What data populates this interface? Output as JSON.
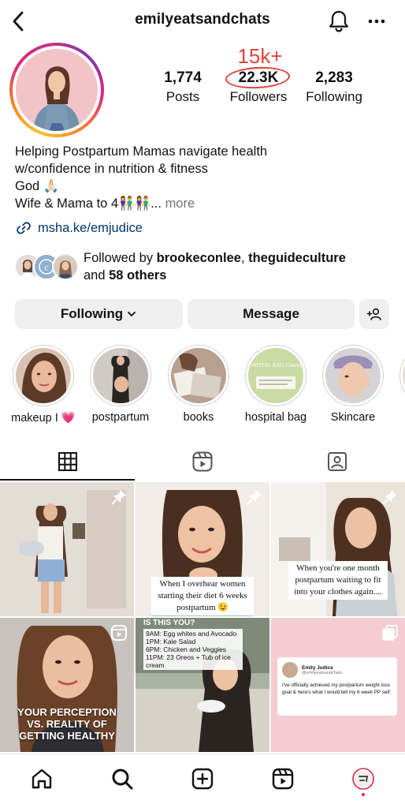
{
  "header": {
    "username": "emilyeatsandchats",
    "icons": {
      "back": "chevron-left-icon",
      "notifications": "bell-icon",
      "more": "more-horizontal-icon"
    }
  },
  "profile": {
    "stats": [
      {
        "value": "1,774",
        "label": "Posts"
      },
      {
        "value": "22.3K",
        "label": "Followers"
      },
      {
        "value": "2,283",
        "label": "Following"
      }
    ],
    "annotation": "15k+",
    "bio": {
      "lines": [
        "Helping Postpartum Mamas navigate health",
        "w/confidence in nutrition & fitness",
        "God 🙏🏻",
        "Wife & Mama to 4👫👫..."
      ],
      "more": "more"
    },
    "link": "msha.ke/emjudice",
    "followed_by": {
      "prefix": "Followed by ",
      "user1": "brookeconlee",
      "sep": ", ",
      "user2": "theguideculture",
      "and": "and ",
      "others": "58 others"
    }
  },
  "actions": {
    "following": "Following",
    "message": "Message"
  },
  "highlights": [
    {
      "label": "makeup I 💗"
    },
    {
      "label": "postpartum"
    },
    {
      "label": "books"
    },
    {
      "label": "hospital bag"
    },
    {
      "label": "Skincare"
    },
    {
      "label": "E"
    }
  ],
  "highlight_thumb_text": "HOSPITAL BAG Checklist",
  "tabs": [
    "grid-icon",
    "reels-icon",
    "tagged-icon"
  ],
  "posts": {
    "p5": [
      "When I overhear women",
      "starting their diet 6 weeks",
      "postpartum 😉"
    ],
    "p6": [
      "When you're one month",
      "postpartum waiting to fit",
      "into your clothes again...."
    ],
    "p7": [
      "YOUR PERCEPTION",
      "VS. REALITY OF",
      "GETTING HEALTHY"
    ],
    "p8_title": "IS THIS YOU?",
    "p8_lines": [
      "9AM: Egg whites and Avocado",
      "1PM: Kale Salad",
      "6PM: Chicken and Veggies",
      "11PM: 23 Oreos + Tub of ice cream"
    ],
    "p9": {
      "name": "Emily Judice",
      "handle": "@emilyeatsandchats",
      "text": "I've officially achieved my postpartum weight loss goal & here's what I would tell my 6 week PP self:"
    }
  },
  "nav": [
    "home-icon",
    "search-icon",
    "create-icon",
    "reels-icon",
    "profile-icon"
  ],
  "colors": {
    "link": "#00376b",
    "annotation": "#e0463c",
    "button_bg": "#efefef",
    "notification_dot": "#e0244b"
  }
}
